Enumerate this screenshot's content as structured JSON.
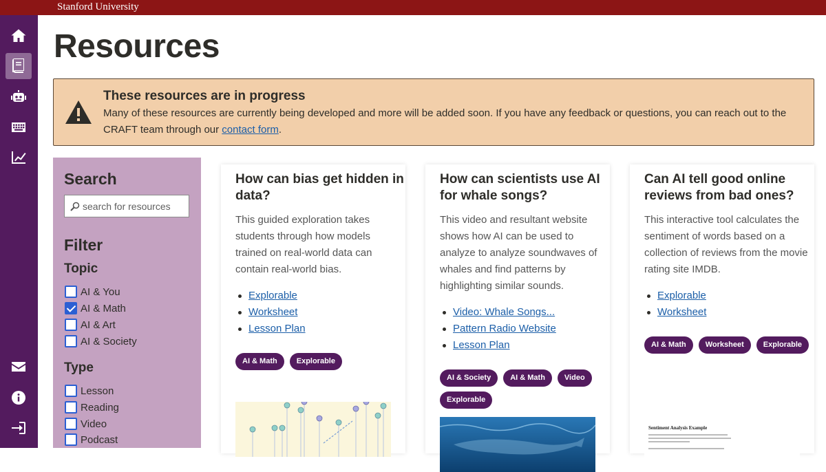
{
  "header": {
    "university": "Stanford University"
  },
  "sidebar": {
    "items": [
      {
        "icon": "home-icon"
      },
      {
        "icon": "book-icon",
        "active": true
      },
      {
        "icon": "robot-icon"
      },
      {
        "icon": "keyboard-icon"
      },
      {
        "icon": "chart-line-icon"
      },
      {
        "icon": "envelope-icon"
      },
      {
        "icon": "info-icon"
      },
      {
        "icon": "sign-in-icon"
      }
    ]
  },
  "page": {
    "title": "Resources"
  },
  "banner": {
    "title": "These resources are in progress",
    "text": "Many of these resources are currently being developed and more will be added soon. If you have any feedback or questions, you can reach out to the CRAFT team through our ",
    "link": "contact form",
    "end": "."
  },
  "filter": {
    "search_heading": "Search",
    "search_placeholder": "search for resources",
    "filter_heading": "Filter",
    "topic_heading": "Topic",
    "topics": [
      {
        "label": "AI & You",
        "checked": false
      },
      {
        "label": "AI & Math",
        "checked": true
      },
      {
        "label": "AI & Art",
        "checked": false
      },
      {
        "label": "AI & Society",
        "checked": false
      }
    ],
    "type_heading": "Type",
    "types": [
      {
        "label": "Lesson",
        "checked": false
      },
      {
        "label": "Reading",
        "checked": false
      },
      {
        "label": "Video",
        "checked": false
      },
      {
        "label": "Podcast",
        "checked": false
      }
    ]
  },
  "cards": [
    {
      "title": "How can bias get hidden in data?",
      "description": "This guided exploration takes students through how models trained on real-world data can contain real-world bias.",
      "links": [
        "Explorable",
        "Worksheet",
        "Lesson Plan"
      ],
      "tags": [
        "AI & Math",
        "Explorable"
      ]
    },
    {
      "title": "How can scientists use AI for whale songs?",
      "description": "This video and resultant website shows how AI can be used to analyze to analyze soundwaves of whales and find patterns by highlighting similar sounds.",
      "links": [
        "Video: Whale Songs...",
        "Pattern Radio Website",
        "Lesson Plan"
      ],
      "tags": [
        "AI & Society",
        "AI & Math",
        "Video",
        "Explorable"
      ]
    },
    {
      "title": "Can AI tell good online reviews from bad ones?",
      "description": "This interactive tool calculates the sentiment of words based on a collection of reviews from the movie rating site IMDB.",
      "links": [
        "Explorable",
        "Worksheet"
      ],
      "tags": [
        "AI & Math",
        "Worksheet",
        "Explorable"
      ],
      "thumb_title": "Sentiment Analysis Example"
    }
  ],
  "colors": {
    "stanford_red": "#8c1515",
    "purple": "#531b5e",
    "panel": "#c4a2c1",
    "banner": "#f2cfaa",
    "link": "#1b5ea8"
  }
}
